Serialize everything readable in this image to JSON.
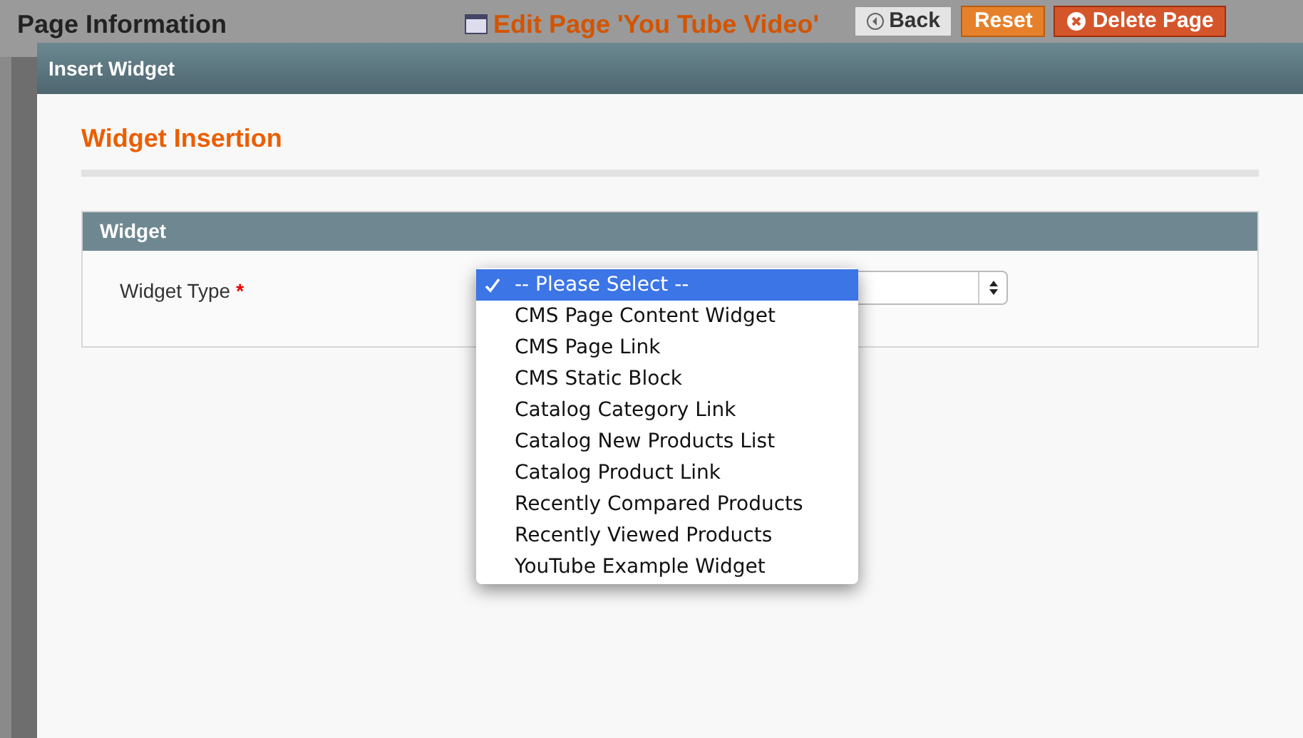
{
  "background_page": {
    "title": "Page Information",
    "edit_title": "Edit Page 'You Tube Video'",
    "buttons": [
      {
        "label": "Back",
        "kind": "back"
      },
      {
        "label": "Reset",
        "kind": "reset"
      },
      {
        "label": "Delete Page",
        "kind": "delete"
      }
    ]
  },
  "dialog": {
    "title": "Insert Widget",
    "heading": "Widget Insertion",
    "section": "Widget",
    "field": {
      "label": "Widget Type",
      "required": true,
      "required_mark": "*",
      "options": [
        {
          "label": "-- Please Select --",
          "selected": true
        },
        {
          "label": "CMS Page Content Widget",
          "selected": false
        },
        {
          "label": "CMS Page Link",
          "selected": false
        },
        {
          "label": "CMS Static Block",
          "selected": false
        },
        {
          "label": "Catalog Category Link",
          "selected": false
        },
        {
          "label": "Catalog New Products List",
          "selected": false
        },
        {
          "label": "Catalog Product Link",
          "selected": false
        },
        {
          "label": "Recently Compared Products",
          "selected": false
        },
        {
          "label": "Recently Viewed Products",
          "selected": false
        },
        {
          "label": "YouTube Example Widget",
          "selected": false
        }
      ]
    }
  }
}
